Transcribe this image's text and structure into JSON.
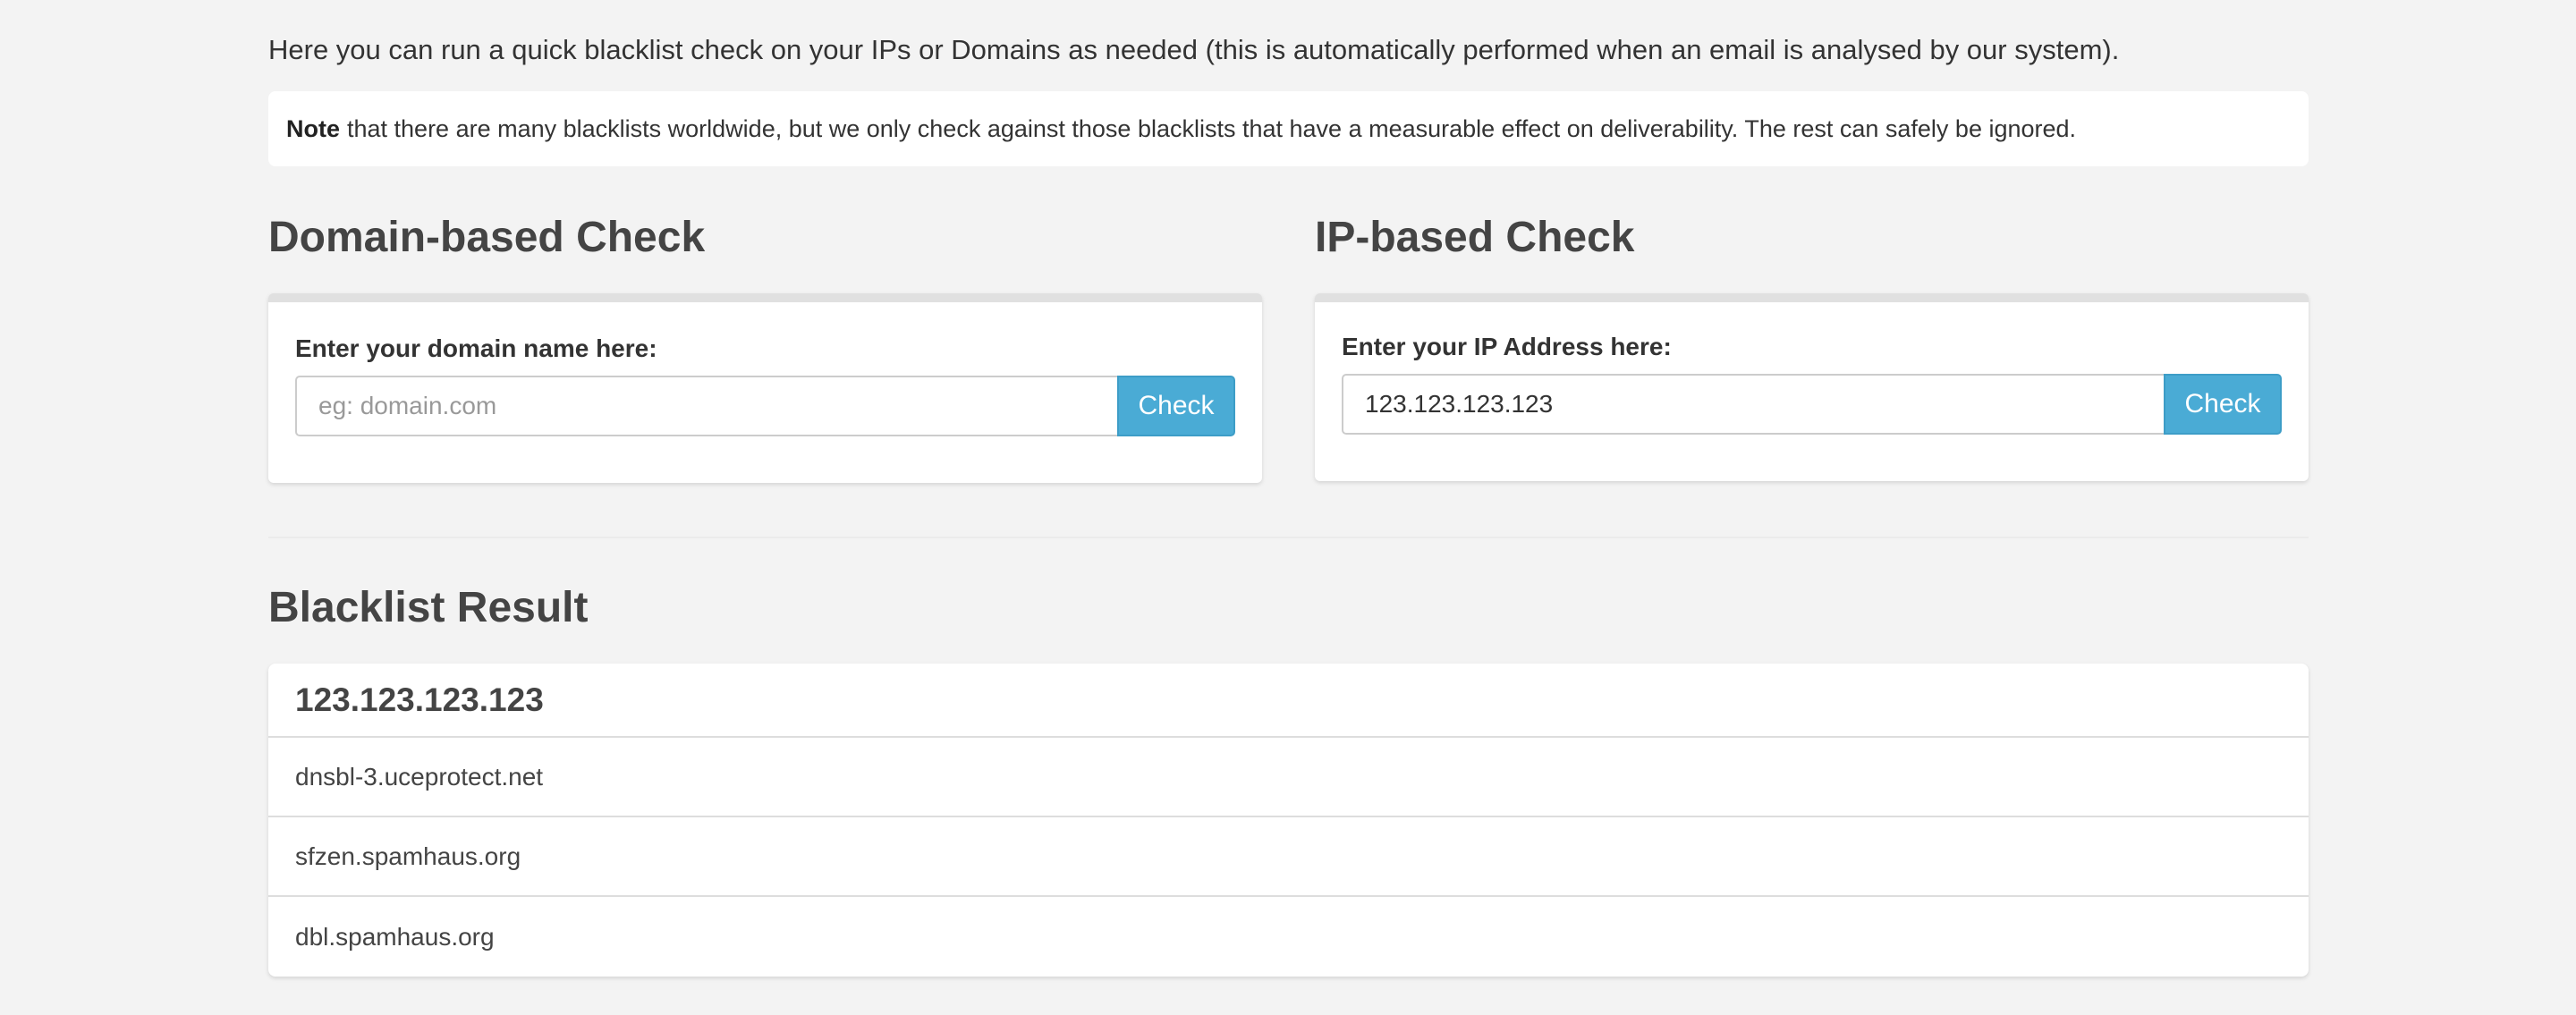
{
  "intro": {
    "text": "Here you can run a quick blacklist check on your IPs or Domains as needed (this is automatically performed when an email is analysed by our system)."
  },
  "note": {
    "bold": "Note",
    "text": "that there are many blacklists worldwide, but we only check against those blacklists that have a measurable effect on deliverability. The rest can safely be ignored."
  },
  "domain_check": {
    "title": "Domain-based Check",
    "label": "Enter your domain name here:",
    "value": "",
    "placeholder": "eg: domain.com",
    "button_label": "Check"
  },
  "ip_check": {
    "title": "IP-based Check",
    "label": "Enter your IP Address here:",
    "value": "123.123.123.123",
    "placeholder": "",
    "button_label": "Check"
  },
  "result": {
    "title": "Blacklist Result",
    "header": "123.123.123.123",
    "rows": [
      "dnsbl-3.uceprotect.net",
      "sfzen.spamhaus.org",
      "dbl.spamhaus.org"
    ]
  },
  "colors": {
    "accent": "#4aabd5",
    "background": "#f3f3f3"
  }
}
